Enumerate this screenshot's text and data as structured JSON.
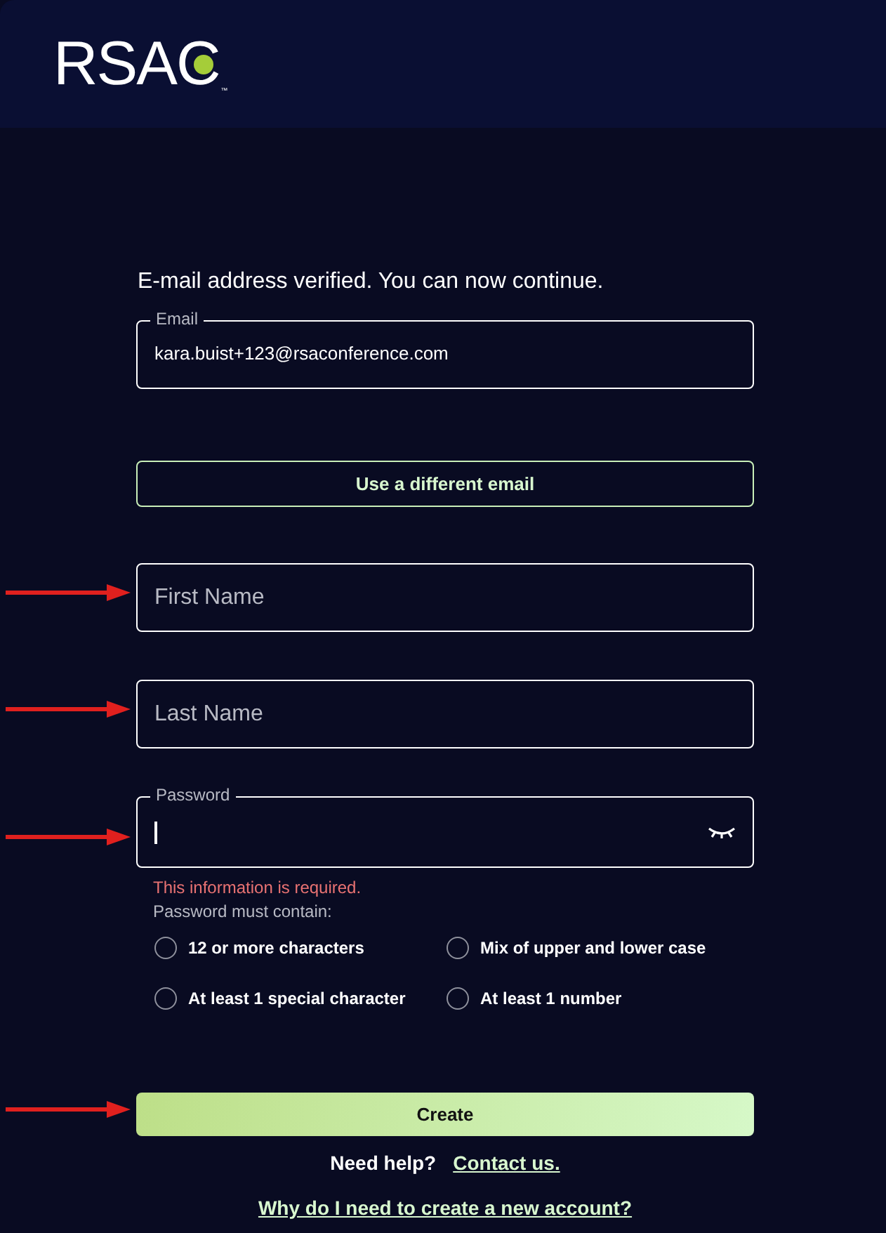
{
  "logo": {
    "text": "RSAC",
    "trademark": "™"
  },
  "message": "E-mail address verified. You can now continue.",
  "email": {
    "label": "Email",
    "value": "kara.buist+123@rsaconference.com"
  },
  "different_email_button": "Use a different email",
  "fields": [
    {
      "placeholder": "First Name",
      "arrow": true
    },
    {
      "placeholder": "Last Name",
      "arrow": true
    }
  ],
  "password": {
    "label": "Password",
    "focused": true,
    "arrow": true,
    "error": "This information is required.",
    "hint": "Password must contain:"
  },
  "requirements": [
    {
      "label": "12 or more characters",
      "checked": false
    },
    {
      "label": "Mix of upper and lower case",
      "checked": false
    },
    {
      "label": "At least 1 special character",
      "checked": false
    },
    {
      "label": "At least 1 number",
      "checked": false
    }
  ],
  "create_button": {
    "label": "Create",
    "arrow": true
  },
  "help": {
    "text": "Need help?",
    "link": "Contact us."
  },
  "why_link": "Why do I need to create a new account?"
}
